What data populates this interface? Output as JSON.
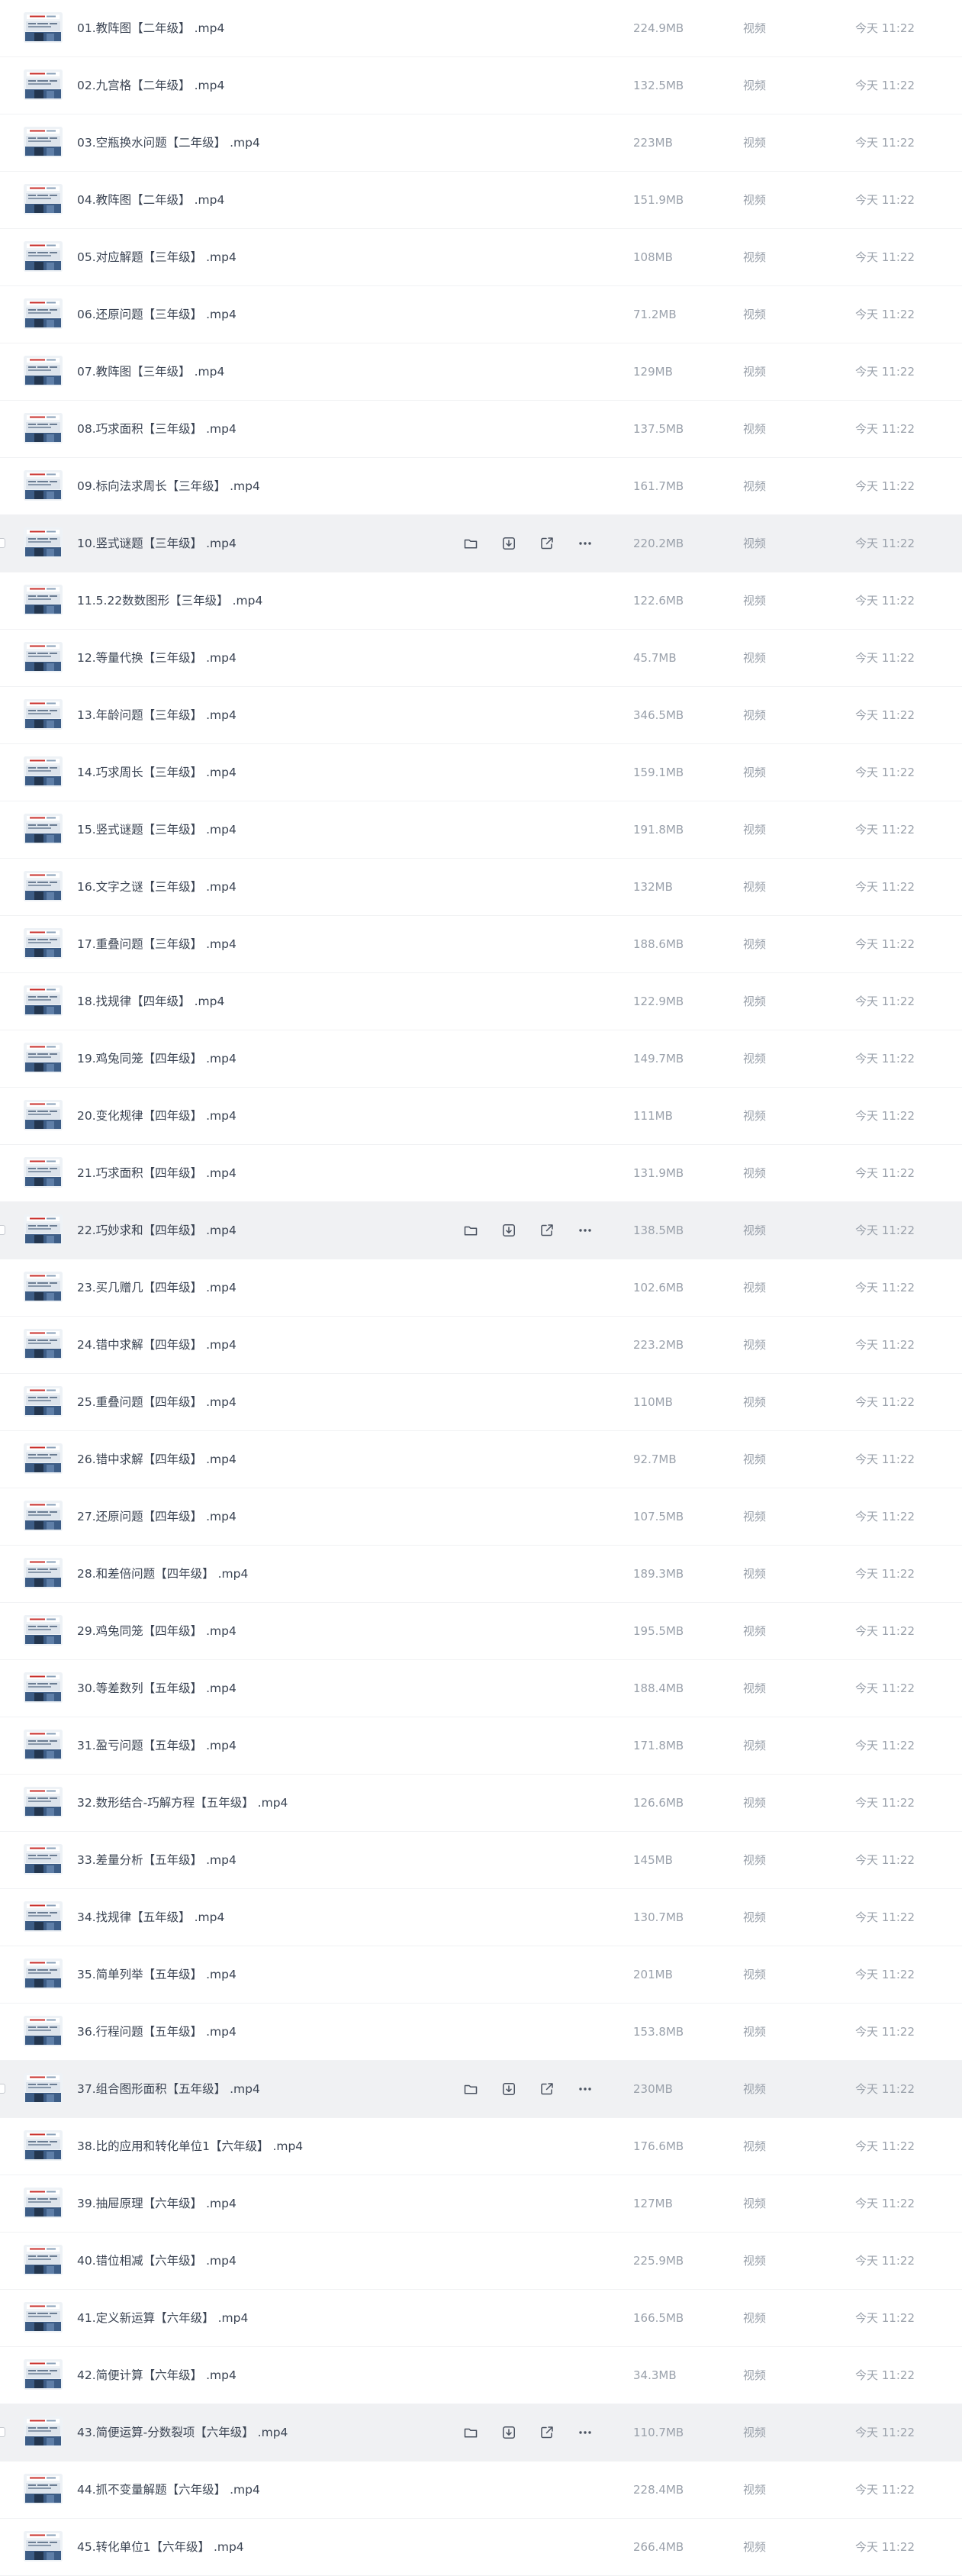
{
  "files": [
    {
      "name": "01.教阵图【二年级】 .mp4",
      "size": "224.9MB",
      "type": "视频",
      "time": "今天 11:22",
      "hover": false
    },
    {
      "name": "02.九宫格【二年级】 .mp4",
      "size": "132.5MB",
      "type": "视频",
      "time": "今天 11:22",
      "hover": false
    },
    {
      "name": "03.空瓶换水问题【二年级】 .mp4",
      "size": "223MB",
      "type": "视频",
      "time": "今天 11:22",
      "hover": false
    },
    {
      "name": "04.教阵图【二年级】 .mp4",
      "size": "151.9MB",
      "type": "视频",
      "time": "今天 11:22",
      "hover": false
    },
    {
      "name": "05.对应解题【三年级】 .mp4",
      "size": "108MB",
      "type": "视频",
      "time": "今天 11:22",
      "hover": false
    },
    {
      "name": "06.还原问题【三年级】 .mp4",
      "size": "71.2MB",
      "type": "视频",
      "time": "今天 11:22",
      "hover": false
    },
    {
      "name": "07.教阵图【三年级】 .mp4",
      "size": "129MB",
      "type": "视频",
      "time": "今天 11:22",
      "hover": false
    },
    {
      "name": "08.巧求面积【三年级】 .mp4",
      "size": "137.5MB",
      "type": "视频",
      "time": "今天 11:22",
      "hover": false
    },
    {
      "name": "09.标向法求周长【三年级】 .mp4",
      "size": "161.7MB",
      "type": "视频",
      "time": "今天 11:22",
      "hover": false
    },
    {
      "name": "10.竖式谜题【三年级】 .mp4",
      "size": "220.2MB",
      "type": "视频",
      "time": "今天 11:22",
      "hover": true
    },
    {
      "name": "11.5.22数数图形【三年级】 .mp4",
      "size": "122.6MB",
      "type": "视频",
      "time": "今天 11:22",
      "hover": false
    },
    {
      "name": "12.等量代换【三年级】 .mp4",
      "size": "45.7MB",
      "type": "视频",
      "time": "今天 11:22",
      "hover": false
    },
    {
      "name": "13.年龄问题【三年级】 .mp4",
      "size": "346.5MB",
      "type": "视频",
      "time": "今天 11:22",
      "hover": false
    },
    {
      "name": "14.巧求周长【三年级】 .mp4",
      "size": "159.1MB",
      "type": "视频",
      "time": "今天 11:22",
      "hover": false
    },
    {
      "name": "15.竖式谜题【三年级】 .mp4",
      "size": "191.8MB",
      "type": "视频",
      "time": "今天 11:22",
      "hover": false
    },
    {
      "name": "16.文字之谜【三年级】 .mp4",
      "size": "132MB",
      "type": "视频",
      "time": "今天 11:22",
      "hover": false
    },
    {
      "name": "17.重叠问题【三年级】 .mp4",
      "size": "188.6MB",
      "type": "视频",
      "time": "今天 11:22",
      "hover": false
    },
    {
      "name": "18.找规律【四年级】 .mp4",
      "size": "122.9MB",
      "type": "视频",
      "time": "今天 11:22",
      "hover": false
    },
    {
      "name": "19.鸡兔同笼【四年级】 .mp4",
      "size": "149.7MB",
      "type": "视频",
      "time": "今天 11:22",
      "hover": false
    },
    {
      "name": "20.变化规律【四年级】 .mp4",
      "size": "111MB",
      "type": "视频",
      "time": "今天 11:22",
      "hover": false
    },
    {
      "name": "21.巧求面积【四年级】 .mp4",
      "size": "131.9MB",
      "type": "视频",
      "time": "今天 11:22",
      "hover": false
    },
    {
      "name": "22.巧妙求和【四年级】 .mp4",
      "size": "138.5MB",
      "type": "视频",
      "time": "今天 11:22",
      "hover": true
    },
    {
      "name": "23.买几赠几【四年级】 .mp4",
      "size": "102.6MB",
      "type": "视频",
      "time": "今天 11:22",
      "hover": false
    },
    {
      "name": "24.错中求解【四年级】 .mp4",
      "size": "223.2MB",
      "type": "视频",
      "time": "今天 11:22",
      "hover": false
    },
    {
      "name": "25.重叠问题【四年级】 .mp4",
      "size": "110MB",
      "type": "视频",
      "time": "今天 11:22",
      "hover": false
    },
    {
      "name": "26.错中求解【四年级】 .mp4",
      "size": "92.7MB",
      "type": "视频",
      "time": "今天 11:22",
      "hover": false
    },
    {
      "name": "27.还原问题【四年级】 .mp4",
      "size": "107.5MB",
      "type": "视频",
      "time": "今天 11:22",
      "hover": false
    },
    {
      "name": "28.和差倍问题【四年级】 .mp4",
      "size": "189.3MB",
      "type": "视频",
      "time": "今天 11:22",
      "hover": false
    },
    {
      "name": "29.鸡兔同笼【四年级】 .mp4",
      "size": "195.5MB",
      "type": "视频",
      "time": "今天 11:22",
      "hover": false
    },
    {
      "name": "30.等差数列【五年级】 .mp4",
      "size": "188.4MB",
      "type": "视频",
      "time": "今天 11:22",
      "hover": false
    },
    {
      "name": "31.盈亏问题【五年级】 .mp4",
      "size": "171.8MB",
      "type": "视频",
      "time": "今天 11:22",
      "hover": false
    },
    {
      "name": "32.数形结合-巧解方程【五年级】 .mp4",
      "size": "126.6MB",
      "type": "视频",
      "time": "今天 11:22",
      "hover": false
    },
    {
      "name": "33.差量分析【五年级】 .mp4",
      "size": "145MB",
      "type": "视频",
      "time": "今天 11:22",
      "hover": false
    },
    {
      "name": "34.找规律【五年级】 .mp4",
      "size": "130.7MB",
      "type": "视频",
      "time": "今天 11:22",
      "hover": false
    },
    {
      "name": "35.简单列举【五年级】 .mp4",
      "size": "201MB",
      "type": "视频",
      "time": "今天 11:22",
      "hover": false
    },
    {
      "name": "36.行程问题【五年级】 .mp4",
      "size": "153.8MB",
      "type": "视频",
      "time": "今天 11:22",
      "hover": false
    },
    {
      "name": "37.组合图形面积【五年级】 .mp4",
      "size": "230MB",
      "type": "视频",
      "time": "今天 11:22",
      "hover": true
    },
    {
      "name": "38.比的应用和转化单位1【六年级】 .mp4",
      "size": "176.6MB",
      "type": "视频",
      "time": "今天 11:22",
      "hover": false
    },
    {
      "name": "39.抽屉原理【六年级】 .mp4",
      "size": "127MB",
      "type": "视频",
      "time": "今天 11:22",
      "hover": false
    },
    {
      "name": "40.错位相减【六年级】 .mp4",
      "size": "225.9MB",
      "type": "视频",
      "time": "今天 11:22",
      "hover": false
    },
    {
      "name": "41.定义新运算【六年级】 .mp4",
      "size": "166.5MB",
      "type": "视频",
      "time": "今天 11:22",
      "hover": false
    },
    {
      "name": "42.简便计算【六年级】 .mp4",
      "size": "34.3MB",
      "type": "视频",
      "time": "今天 11:22",
      "hover": false
    },
    {
      "name": "43.简便运算-分数裂项【六年级】 .mp4",
      "size": "110.7MB",
      "type": "视频",
      "time": "今天 11:22",
      "hover": true
    },
    {
      "name": "44.抓不变量解题【六年级】 .mp4",
      "size": "228.4MB",
      "type": "视频",
      "time": "今天 11:22",
      "hover": false
    },
    {
      "name": "45.转化单位1【六年级】 .mp4",
      "size": "266.4MB",
      "type": "视频",
      "time": "今天 11:22",
      "hover": false
    }
  ],
  "icons": {
    "thumbnail": "video-thumbnail",
    "actions": [
      "folder-icon",
      "download-icon",
      "share-icon",
      "more-icon"
    ]
  },
  "colors": {
    "hover_bg": "#f0f1f3",
    "text": "#3b4453",
    "muted": "#9aa1ab",
    "icon": "#4a5260"
  }
}
